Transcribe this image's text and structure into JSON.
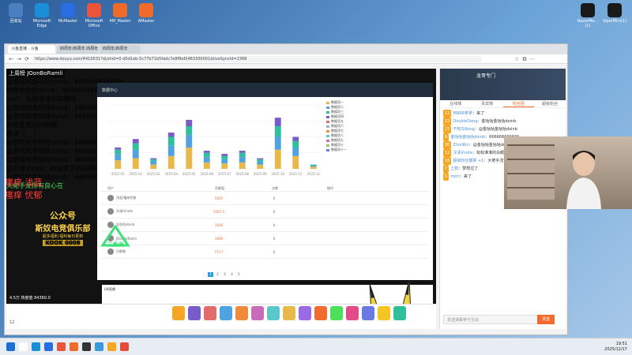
{
  "desktop": {
    "icons": [
      {
        "label": "回收站",
        "color": "#4a7fc1"
      },
      {
        "label": "Microsoft Edge",
        "color": "#1b8fd6"
      },
      {
        "label": "McMaster",
        "color": "#2a6de0"
      },
      {
        "label": "Microsoft Office",
        "color": "#e8553b"
      },
      {
        "label": "4M_Master",
        "color": "#f06b2a"
      },
      {
        "label": "AMaster",
        "color": "#f06b2a"
      }
    ],
    "right_icons": [
      {
        "label": "RazerMe...(1)"
      },
      {
        "label": "ViperMini(1)"
      }
    ]
  },
  "browser": {
    "tabs": [
      "斗鱼直播 · 斗鱼",
      "四周年/四周年 四周年",
      "四周年/四周年"
    ],
    "url": "https://www.douyu.com/4410031?dyshid=0-d0d1eb-5c77b71b5fadc7e8ffbd5483300001&liveSyncId=2368"
  },
  "stream": {
    "streamer_tag": "上周榜 JOonBoRamli",
    "danmaku": [
      {
        "text": "标标准准的白眼猴",
        "style": "main"
      },
      {
        "text": "@金咕咕金咕咕doinb：666666666666",
        "style": "badge"
      },
      {
        "text": "咕咕金咕咕doinb：666666666666",
        "style": "main"
      },
      {
        "text": "icon：标标准准的白眼猴",
        "style": "main"
      },
      {
        "text": "@金咕咕金咕咕doinb：666666666666",
        "style": "main"
      },
      {
        "text": "@金咕咕金咕咕doinb：666666666666",
        "style": "main"
      },
      {
        "text": "标标准准的白眼猴",
        "style": "dim"
      },
      {
        "text": "表演（_ _）",
        "style": "dim"
      },
      {
        "text": "@金咕咕金咕咕doinb：666666666666",
        "style": "dim"
      },
      {
        "text": "@金咕咕金咕咕doinb：666666666666",
        "style": "dim"
      },
      {
        "text": "@金咕咕金咕咕doinb：666666666666",
        "style": "dim"
      },
      {
        "text": "@冷清Vnote：标标准准的白眼猴",
        "style": "dim"
      },
      {
        "text": "@金咕咕金咕咕doinb：666666666666",
        "style": "dim"
      },
      {
        "text": "大佬手龙你有良心在",
        "style": "green"
      }
    ],
    "side_text_left": [
      "瘙痒 浅蓝",
      "瘙痒 忧郁"
    ],
    "promo": {
      "title": "公众号",
      "subtitle": "斯奴电竞俱乐部",
      "tagline": "超多福利·福利每日更新",
      "kook": "KOOK 0008"
    },
    "overlay_label": "三角洲",
    "dash": {
      "header": "数据中心",
      "table_headers": [
        "用户",
        "贡献值",
        "次数",
        "操作"
      ],
      "rows": [
        {
          "name": "浅蓝/瘙痒忧郁",
          "value": "5025",
          "count": "0"
        },
        {
          "name": "冷清/Vnote",
          "value": "1027.4",
          "count": "0"
        },
        {
          "name": "金咕咕doinb",
          "value": "1016",
          "count": "0"
        },
        {
          "name": "JOonBoRamli",
          "value": "1000",
          "count": "0"
        },
        {
          "name": "白眼猴",
          "value": "774.7",
          "count": "0"
        }
      ],
      "pager": [
        "1",
        "2",
        "3",
        "4",
        "5"
      ],
      "legend": [
        "数据项一",
        "数据项二",
        "数据项三",
        "数据项四",
        "数据项五",
        "数据项六",
        "数据项七",
        "数据项八",
        "数据项九",
        "数据项十",
        "数据项十一"
      ],
      "bottom_label": "LW直播"
    },
    "bottom_bar": {
      "viewers": "4.5万 热度值 84360.0",
      "gift_count": "12"
    }
  },
  "chat": {
    "room_title": "龙哥专门",
    "tabs": [
      "在线榜",
      "贵宾榜",
      "粉丝团",
      "超级粉丝"
    ],
    "lines": [
      {
        "level": "11",
        "user": "MRRR拿拿",
        "text": "来了"
      },
      {
        "level": "23",
        "user": "DoubleDong",
        "text": "金咕咕金咕咕doinb"
      },
      {
        "level": "15",
        "user": "不死鸟Kong",
        "text": "@金咕咕金咕咕doinb"
      },
      {
        "level": "9",
        "user": "金咕咕金咕咕doinb",
        "text": "666666666666"
      },
      {
        "level": "30",
        "user": "ZhixiRin",
        "text": "@金咕咕金咕咕doinb"
      },
      {
        "level": "12",
        "user": "冷清Vnote",
        "text": "标标准准的白眼猴"
      },
      {
        "level": "18",
        "user": "超级粉丝徽章 +1",
        "text": "大佬手龙你有良心在"
      },
      {
        "level": "7",
        "user": "土狗",
        "text": "梦想过了"
      },
      {
        "level": "5",
        "user": "mzcl",
        "text": "来了"
      }
    ],
    "input_placeholder": "发送弹幕参与互动",
    "send": "发送"
  },
  "taskbar": {
    "time": "19:51",
    "date": "2025/12/17"
  },
  "chart_data": {
    "type": "bar",
    "categories": [
      "2025-01",
      "2025-02",
      "2025-03",
      "2025-04",
      "2025-05",
      "2025-06",
      "2025-07",
      "2025-08",
      "2025-09",
      "2025-10",
      "2025-11",
      "2025-12"
    ],
    "series": [
      {
        "values": [
          8,
          10,
          4,
          12,
          20,
          6,
          5,
          6,
          4,
          18,
          12,
          2
        ]
      },
      {
        "values": [
          6,
          8,
          3,
          10,
          12,
          5,
          4,
          5,
          3,
          12,
          8,
          1
        ]
      },
      {
        "values": [
          4,
          6,
          2,
          8,
          8,
          4,
          3,
          4,
          2,
          10,
          6,
          1
        ]
      },
      {
        "values": [
          2,
          4,
          1,
          4,
          6,
          2,
          2,
          2,
          1,
          8,
          4,
          0
        ]
      }
    ],
    "colors": [
      "#e8b84a",
      "#4fa3e0",
      "#2fbf9a",
      "#7a5cc8"
    ],
    "ylim": [
      0,
      60
    ]
  }
}
